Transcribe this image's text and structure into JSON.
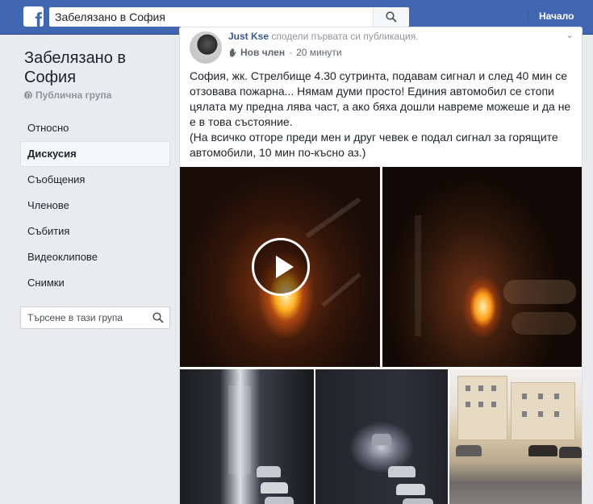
{
  "topbar": {
    "logo_icon": "facebook-f-icon",
    "search_value": "Забелязано в София",
    "search_icon": "search-icon",
    "home_label": "Начало",
    "colors": {
      "bar": "#4267b2",
      "link": "#385898"
    }
  },
  "group": {
    "title": "Забелязано в София",
    "privacy": "Публична група",
    "privacy_icon": "globe-icon"
  },
  "nav": {
    "items": [
      {
        "label": "Относно",
        "active": false
      },
      {
        "label": "Дискусия",
        "active": true
      },
      {
        "label": "Съобщения",
        "active": false
      },
      {
        "label": "Членове",
        "active": false
      },
      {
        "label": "Събития",
        "active": false
      },
      {
        "label": "Видеоклипове",
        "active": false
      },
      {
        "label": "Снимки",
        "active": false
      }
    ]
  },
  "group_search": {
    "placeholder": "Търсене в тази група",
    "icon": "search-icon"
  },
  "post": {
    "author": "Just Kse",
    "action": "сподели първата си публикация.",
    "badge": "Нов член",
    "badge_icon": "waving-hand-icon",
    "time": "20 минути",
    "text_line1": "София, жк. Стрелбище 4.30 сутринта, подавам сигнал и след 40 мин се отзовава пожарна... Нямам думи просто! Единия автомобил се стопи цялата му предна лява част, а ако бяха дошли навреме можеше и да не е в това състояние.",
    "text_line2": "(На всичко отгоре преди мен и друг чевек е подал сигнал за горящите автомобили, 10 мин по-късно аз.)",
    "photos": [
      {
        "name": "video-thumbnail",
        "video": true
      },
      {
        "name": "photo"
      },
      {
        "name": "photo"
      },
      {
        "name": "photo"
      },
      {
        "name": "photo"
      }
    ]
  }
}
